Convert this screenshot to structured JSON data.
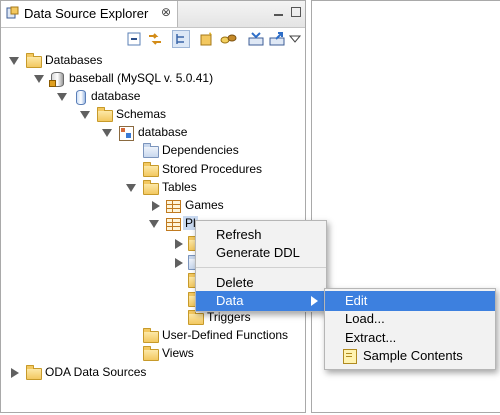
{
  "view": {
    "title": "Data Source Explorer",
    "close_glyph": "⊗"
  },
  "toolbar": {
    "icons": [
      "collapse-all-icon",
      "link-with-editor-icon",
      "filter-icon",
      "new-connection-icon",
      "connect-icon",
      "import-icon",
      "export-icon",
      "view-menu-icon"
    ]
  },
  "tree": {
    "databases": "Databases",
    "baseball": "baseball (MySQL v. 5.0.41)",
    "database_node": "database",
    "schemas": "Schemas",
    "schema_database": "database",
    "dependencies": "Dependencies",
    "stored_procedures": "Stored Procedures",
    "tables": "Tables",
    "games": "Games",
    "players": "Pl",
    "triggers": "Triggers",
    "udf": "User-Defined Functions",
    "views": "Views",
    "oda": "ODA Data Sources"
  },
  "context_menu": {
    "refresh": "Refresh",
    "generate_ddl": "Generate DDL",
    "delete": "Delete",
    "data": "Data"
  },
  "submenu": {
    "edit": "Edit",
    "load": "Load...",
    "extract": "Extract...",
    "sample": "Sample Contents"
  },
  "colors": {
    "selection": "#3d80df",
    "menu_bg": "#f2f2f2"
  }
}
